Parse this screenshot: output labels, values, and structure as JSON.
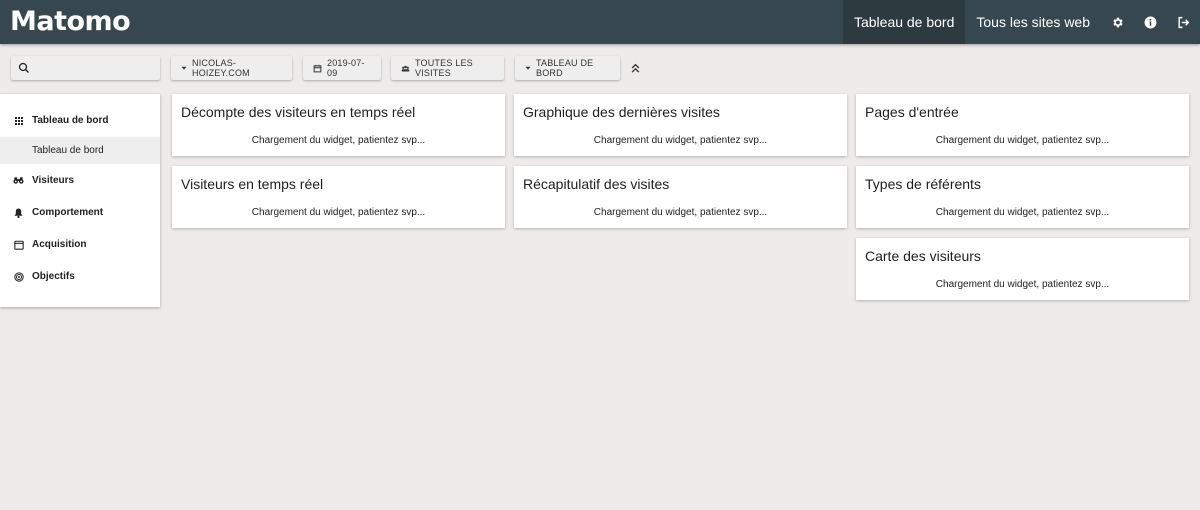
{
  "header": {
    "logo": "Matomo",
    "nav": [
      {
        "label": "Tableau de bord",
        "active": true
      },
      {
        "label": "Tous les sites web",
        "active": false
      }
    ],
    "icons": [
      "gear-icon",
      "info-icon",
      "logout-icon"
    ],
    "bg_color": "#37474f"
  },
  "controls": {
    "search_placeholder": "",
    "site": "NICOLAS-HOIZEY.COM",
    "date": "2019-07-09",
    "segment": "TOUTES LES VISITES",
    "dashboard": "TABLEAU DE BORD"
  },
  "sidebar": {
    "items": [
      {
        "label": "Tableau de bord",
        "icon": "grid-icon"
      },
      {
        "label": "Visiteurs",
        "icon": "binoculars-icon"
      },
      {
        "label": "Comportement",
        "icon": "bell-icon"
      },
      {
        "label": "Acquisition",
        "icon": "calendar-icon"
      },
      {
        "label": "Objectifs",
        "icon": "target-icon"
      }
    ],
    "subitem": "Tableau de bord"
  },
  "widgets": [
    {
      "title": "Décompte des visiteurs en temps réel",
      "loading": "Chargement du widget, patientez svp..."
    },
    {
      "title": "Visiteurs en temps réel",
      "loading": "Chargement du widget, patientez svp..."
    },
    {
      "title": "Graphique des dernières visites",
      "loading": "Chargement du widget, patientez svp..."
    },
    {
      "title": "Récapitulatif des visites",
      "loading": "Chargement du widget, patientez svp..."
    },
    {
      "title": "Pages d'entrée",
      "loading": "Chargement du widget, patientez svp..."
    },
    {
      "title": "Types de référents",
      "loading": "Chargement du widget, patientez svp..."
    },
    {
      "title": "Carte des visiteurs",
      "loading": "Chargement du widget, patientez svp..."
    }
  ]
}
